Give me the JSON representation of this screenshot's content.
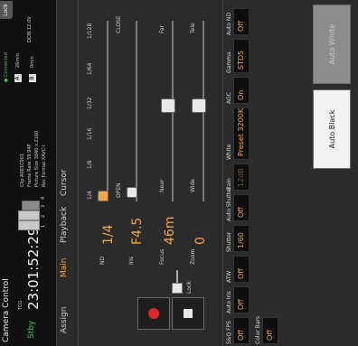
{
  "status": {
    "title": "Camera Control",
    "state": "Stby",
    "tcg_label": "TCG",
    "timecode": "23:01:52:29",
    "rec_indicator_label": "MEDIA",
    "slots": [
      "1",
      "2",
      "3",
      "4"
    ],
    "clip_info": [
      "Clip A001C001",
      "Frame Rate 59.94P",
      "Picture Size 3840 x 2160",
      "Rec Format XAVC-I"
    ],
    "connected": "● Connected",
    "media_a_label": "A",
    "media_a_time": "26min",
    "media_b_label": "B",
    "media_b_time": "0min",
    "dcin": "DCIN 12.0V",
    "lock_label": "Lock"
  },
  "tabs": [
    {
      "label": "Assign",
      "active": false
    },
    {
      "label": "Main",
      "active": true
    },
    {
      "label": "Playback",
      "active": false
    },
    {
      "label": "Cursor",
      "active": false
    }
  ],
  "controls": {
    "nd_label": "ND",
    "nd_value": "1/4",
    "nd_scale": [
      "1/4",
      "1/8",
      "1/16",
      "1/32",
      "1/64",
      "1/128"
    ],
    "iris_label": "Iris",
    "iris_value": "F4.5",
    "iris_open": "OPEN",
    "iris_close": "CLOSE",
    "focus_label": "Focus",
    "focus_value": "46m",
    "focus_near": "Near",
    "focus_far": "Far",
    "zoom_label": "Zoom",
    "zoom_value": "0",
    "zoom_wide": "Wide",
    "zoom_tele": "Tele",
    "lock_switch_label": "Lock"
  },
  "params": [
    {
      "label": "S&Q FPS",
      "value": "Off"
    },
    {
      "label": "Shutter",
      "value": "1/60"
    },
    {
      "label": "White",
      "value": "Preset 3200K"
    },
    {
      "label": "Gamma",
      "value": "STD5"
    },
    {
      "label": "Auto Iris",
      "value": "Off"
    },
    {
      "label": "Auto Shutter",
      "value": "Off"
    },
    {
      "label": "AGC",
      "value": "On"
    },
    {
      "label": "Auto ND",
      "value": "Off"
    },
    {
      "label": "ATW",
      "value": "Off"
    },
    {
      "label": "Gain",
      "value": "12dB"
    },
    {
      "label": "Color Bars",
      "value": "Off"
    }
  ],
  "buttons": {
    "auto_black": "Auto Black",
    "auto_white": "Auto White"
  },
  "colors": {
    "accent": "#f0a64a",
    "rec": "#e0262a",
    "connected": "#36c24a"
  }
}
